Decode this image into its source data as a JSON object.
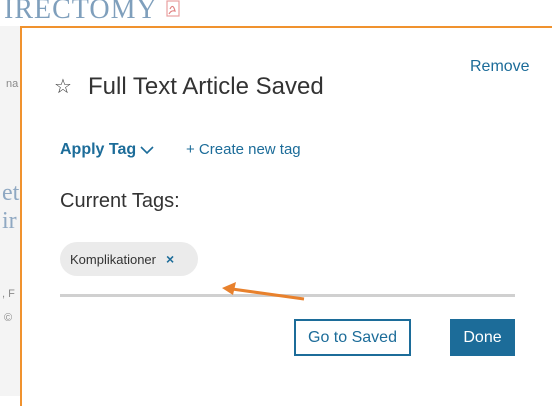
{
  "background": {
    "title_fragment": "IRECTOMY",
    "side_fragments": [
      "na",
      "et",
      "ir",
      ", F",
      "©"
    ]
  },
  "modal": {
    "title": "Full Text Article Saved",
    "remove_label": "Remove",
    "apply_tag_label": "Apply Tag",
    "create_tag_label": "+ Create new tag",
    "current_tags_label": "Current Tags:",
    "tags": [
      {
        "label": "Komplikationer",
        "remove_glyph": "×"
      }
    ],
    "go_to_saved_label": "Go to Saved",
    "done_label": "Done"
  },
  "colors": {
    "accent": "#1c6c99",
    "frame": "#f0922e",
    "annotation_arrow": "#e8812d",
    "chip_bg": "#ebebeb"
  },
  "icons": {
    "title": "star-outline-icon",
    "apply_tag": "chevron-down-icon",
    "tag_remove": "close-icon",
    "background_pdf": "pdf-icon"
  }
}
